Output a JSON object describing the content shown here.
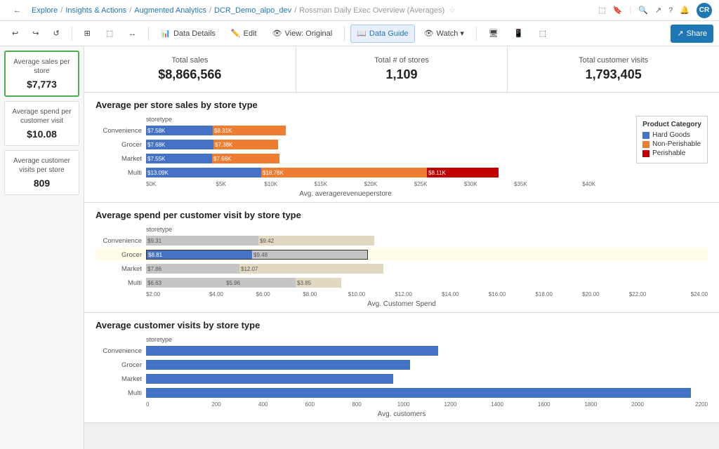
{
  "topbar": {
    "back_label": "←",
    "explore": "Explore",
    "sep1": "/",
    "insights": "Insights & Actions",
    "sep2": "/",
    "augmented": "Augmented Analytics",
    "sep3": "/",
    "project": "DCR_Demo_alpo_dev",
    "sep4": "/",
    "title": "Rossman Daily Exec Overview (Averages)"
  },
  "toolbar": {
    "undo": "↩",
    "redo": "↪",
    "icon1": "⊞",
    "icon2": "⬚",
    "icon3": "↔",
    "data_details": "Data Details",
    "edit": "Edit",
    "view_original": "View: Original",
    "data_guide": "Data Guide",
    "watch": "Watch ▾",
    "t1": "🖥",
    "t2": "📱",
    "t3": "⬚",
    "share": "Share"
  },
  "stat_cards": [
    {
      "title": "Total sales",
      "value": "$8,866,566"
    },
    {
      "title": "Total # of stores",
      "value": "1,109"
    },
    {
      "title": "Total customer visits",
      "value": "1,793,405"
    }
  ],
  "sidebar_cards": [
    {
      "title": "Average sales per store",
      "value": "$7,773",
      "selected": true
    },
    {
      "title": "Average spend per customer visit",
      "value": "$10.08",
      "selected": false
    },
    {
      "title": "Average customer visits per store",
      "value": "809",
      "selected": false
    }
  ],
  "chart1": {
    "title": "Average per store sales by store type",
    "xlabel": "Avg. averagerevenueperstore",
    "legend": {
      "title": "Product Category",
      "items": [
        {
          "label": "Hard Goods",
          "color": "#4472C4"
        },
        {
          "label": "Non-Perishable",
          "color": "#ED7D31"
        },
        {
          "label": "Perishable",
          "color": "#C00000"
        }
      ]
    },
    "rows": [
      {
        "label": "Convenience",
        "segs": [
          {
            "val": "$7.58K",
            "color": "#4472C4",
            "pct": 19
          },
          {
            "val": "$8.31K",
            "color": "#ED7D31",
            "pct": 21
          }
        ]
      },
      {
        "label": "Grocer",
        "segs": [
          {
            "val": "$7.68K",
            "color": "#4472C4",
            "pct": 19
          },
          {
            "val": "$7.38K",
            "color": "#ED7D31",
            "pct": 18
          }
        ]
      },
      {
        "label": "Market",
        "segs": [
          {
            "val": "$7.55K",
            "color": "#4472C4",
            "pct": 19
          },
          {
            "val": "$7.66K",
            "color": "#ED7D31",
            "pct": 19
          }
        ]
      },
      {
        "label": "Multi",
        "segs": [
          {
            "val": "$13.09K",
            "color": "#4472C4",
            "pct": 33
          },
          {
            "val": "$18.78K",
            "color": "#ED7D31",
            "pct": 48
          },
          {
            "val": "$8.11K",
            "color": "#C00000",
            "pct": 21
          }
        ]
      }
    ],
    "x_ticks": [
      "$0K",
      "$5K",
      "$10K",
      "$15K",
      "$20K",
      "$25K",
      "$30K",
      "$35K",
      "$40K"
    ]
  },
  "chart2": {
    "title": "Average spend per customer visit by store type",
    "xlabel": "Avg. Customer Spend",
    "rows": [
      {
        "label": "Convenience",
        "segs": [
          {
            "val": "$9.31",
            "color": "#C5C5C5",
            "pct": 38
          },
          {
            "val": "$9.42",
            "color": "#E0D8C0",
            "pct": 39
          }
        ]
      },
      {
        "label": "Grocer",
        "segs": [
          {
            "val": "$8.81",
            "color": "#4472C4",
            "pct": 36,
            "highlight": true
          },
          {
            "val": "$9.48",
            "color": "#C5C5C5",
            "pct": 39
          }
        ]
      },
      {
        "label": "Market",
        "segs": [
          {
            "val": "$7.86",
            "color": "#C5C5C5",
            "pct": 32
          },
          {
            "val": "$12.07",
            "color": "#E0D8C0",
            "pct": 49
          }
        ]
      },
      {
        "label": "Multi",
        "segs": [
          {
            "val": "$6.63",
            "color": "#C5C5C5",
            "pct": 27
          },
          {
            "val": "$5.96",
            "color": "#C5C5C5",
            "pct": 24
          },
          {
            "val": "$3.85",
            "color": "#E0D8C0",
            "pct": 16
          }
        ]
      }
    ],
    "x_ticks": [
      "$2.00",
      "$4.00",
      "$6.00",
      "$8.00",
      "$10.00",
      "$12.00",
      "$14.00",
      "$16.00",
      "$18.00",
      "$20.00",
      "$22.00",
      "$24.00"
    ]
  },
  "chart3": {
    "title": "Average customer visits by store type",
    "xlabel": "Avg. customers",
    "rows": [
      {
        "label": "Convenience",
        "pct": 52,
        "color": "#4472C4"
      },
      {
        "label": "Grocer",
        "pct": 47,
        "color": "#4472C4"
      },
      {
        "label": "Market",
        "pct": 44,
        "color": "#4472C4"
      },
      {
        "label": "Multi",
        "pct": 97,
        "color": "#4472C4"
      }
    ],
    "x_ticks": [
      "0",
      "200",
      "400",
      "600",
      "800",
      "1000",
      "1200",
      "1400",
      "1600",
      "1800",
      "2000",
      "2200"
    ]
  },
  "colors": {
    "blue": "#4472C4",
    "orange": "#ED7D31",
    "red": "#C00000",
    "green": "#4CAF50",
    "accent": "#1f77b4"
  }
}
